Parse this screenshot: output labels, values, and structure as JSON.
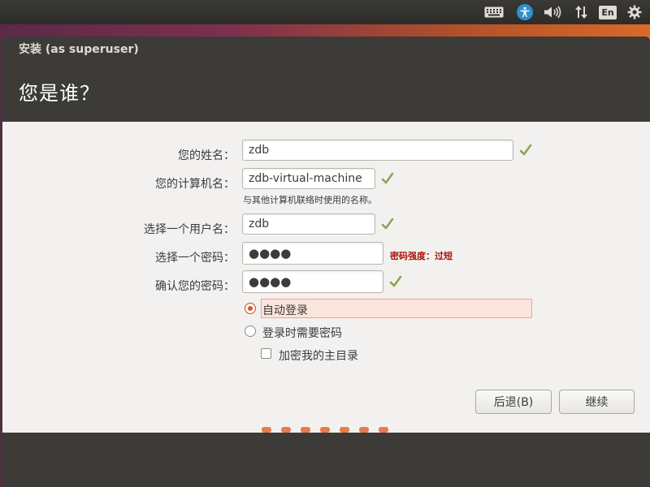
{
  "top_panel": {
    "language": "En",
    "icons": [
      "keyboard-icon",
      "accessibility-icon",
      "sound-icon",
      "network-icon",
      "settings-icon"
    ]
  },
  "window": {
    "title": "安装 (as superuser)",
    "page_title": "您是谁？"
  },
  "form": {
    "name": {
      "label": "您的姓名：",
      "value": "zdb",
      "valid": true
    },
    "computer": {
      "label": "您的计算机名：",
      "value": "zdb-virtual-machine",
      "valid": true,
      "hint": "与其他计算机联络时使用的名称。"
    },
    "username": {
      "label": "选择一个用户名：",
      "value": "zdb",
      "valid": true
    },
    "password": {
      "label": "选择一个密码：",
      "value": "●●●●",
      "strength": "密码强度：过短"
    },
    "confirm": {
      "label": "确认您的密码：",
      "value": "●●●●",
      "valid": true
    }
  },
  "login_options": {
    "auto_login": {
      "label": "自动登录",
      "selected": true
    },
    "require_password": {
      "label": "登录时需要密码",
      "selected": false
    },
    "encrypt_home": {
      "label": "加密我的主目录",
      "checked": false
    }
  },
  "buttons": {
    "back": "后退(B)",
    "continue": "继续"
  },
  "progress": {
    "steps": 7
  },
  "colors": {
    "accent": "#e05520",
    "check": "#87a752",
    "strength_warning": "#a8150d",
    "window_bg": "#3c3b37"
  }
}
